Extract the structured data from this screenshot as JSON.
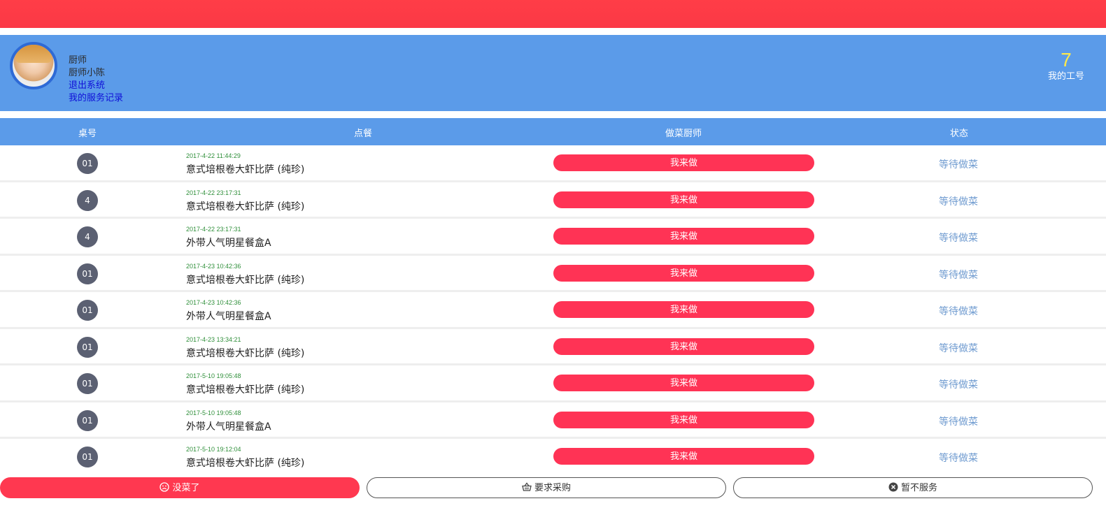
{
  "profile": {
    "role": "厨师",
    "name": "厨师小陈",
    "logout": "退出系统",
    "records": "我的服务记录",
    "work_number": "7",
    "work_number_label": "我的工号"
  },
  "table_header": {
    "col_table": "桌号",
    "col_order": "点餐",
    "col_chef": "做菜厨师",
    "col_status": "状态"
  },
  "orders": [
    {
      "table": "01",
      "time": "2017-4-22 11:44:29",
      "dish": "意式培根卷大虾比萨 (纯珍)",
      "action": "我来做",
      "status": "等待做菜"
    },
    {
      "table": "4",
      "time": "2017-4-22 23:17:31",
      "dish": "意式培根卷大虾比萨 (纯珍)",
      "action": "我来做",
      "status": "等待做菜"
    },
    {
      "table": "4",
      "time": "2017-4-22 23:17:31",
      "dish": "外带人气明星餐盒A",
      "action": "我来做",
      "status": "等待做菜"
    },
    {
      "table": "01",
      "time": "2017-4-23 10:42:36",
      "dish": "意式培根卷大虾比萨 (纯珍)",
      "action": "我来做",
      "status": "等待做菜"
    },
    {
      "table": "01",
      "time": "2017-4-23 10:42:36",
      "dish": "外带人气明星餐盒A",
      "action": "我来做",
      "status": "等待做菜"
    },
    {
      "table": "01",
      "time": "2017-4-23 13:34:21",
      "dish": "意式培根卷大虾比萨 (纯珍)",
      "action": "我来做",
      "status": "等待做菜"
    },
    {
      "table": "01",
      "time": "2017-5-10 19:05:48",
      "dish": "意式培根卷大虾比萨 (纯珍)",
      "action": "我来做",
      "status": "等待做菜"
    },
    {
      "table": "01",
      "time": "2017-5-10 19:05:48",
      "dish": "外带人气明星餐盒A",
      "action": "我来做",
      "status": "等待做菜"
    },
    {
      "table": "01",
      "time": "2017-5-10 19:12:04",
      "dish": "意式培根卷大虾比萨 (纯珍)",
      "action": "我来做",
      "status": "等待做菜"
    }
  ],
  "footer": {
    "no_dish": "没菜了",
    "purchase": "要求采购",
    "pause": "暂不服务"
  },
  "icons": {
    "no_dish": "sad-face-icon",
    "purchase": "basket-icon",
    "pause": "close-circle-icon"
  },
  "colors": {
    "brand_red": "#ff3850",
    "header_blue": "#5b9be9",
    "work_number": "#ffe94a",
    "status_text": "#6f9bd0"
  }
}
